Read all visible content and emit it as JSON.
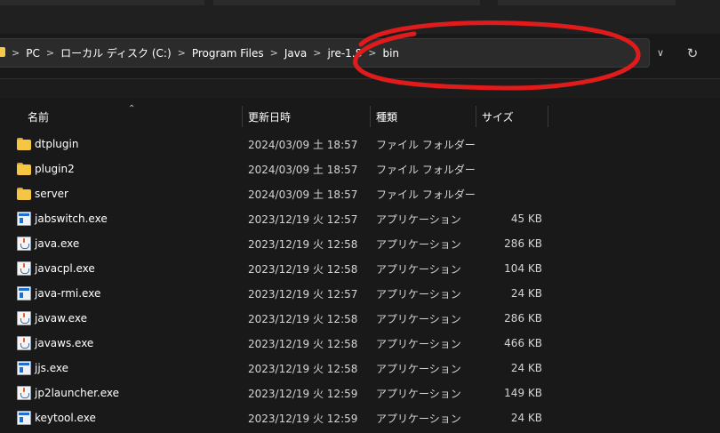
{
  "address_bar": {
    "path": [
      "PC",
      "ローカル ディスク (C:)",
      "Program Files",
      "Java",
      "jre-1.8",
      "bin"
    ]
  },
  "columns": {
    "name": "名前",
    "date": "更新日時",
    "type": "種類",
    "size": "サイズ"
  },
  "files": [
    {
      "name": "dtplugin",
      "date": "2024/03/09 土 18:57",
      "type": "ファイル フォルダー",
      "size": "",
      "icon": "folder-icon"
    },
    {
      "name": "plugin2",
      "date": "2024/03/09 土 18:57",
      "type": "ファイル フォルダー",
      "size": "",
      "icon": "folder-icon"
    },
    {
      "name": "server",
      "date": "2024/03/09 土 18:57",
      "type": "ファイル フォルダー",
      "size": "",
      "icon": "folder-icon"
    },
    {
      "name": "jabswitch.exe",
      "date": "2023/12/19 火 12:57",
      "type": "アプリケーション",
      "size": "45 KB",
      "icon": "application-icon"
    },
    {
      "name": "java.exe",
      "date": "2023/12/19 火 12:58",
      "type": "アプリケーション",
      "size": "286 KB",
      "icon": "java-icon"
    },
    {
      "name": "javacpl.exe",
      "date": "2023/12/19 火 12:58",
      "type": "アプリケーション",
      "size": "104 KB",
      "icon": "java-icon"
    },
    {
      "name": "java-rmi.exe",
      "date": "2023/12/19 火 12:57",
      "type": "アプリケーション",
      "size": "24 KB",
      "icon": "application-icon"
    },
    {
      "name": "javaw.exe",
      "date": "2023/12/19 火 12:58",
      "type": "アプリケーション",
      "size": "286 KB",
      "icon": "java-icon"
    },
    {
      "name": "javaws.exe",
      "date": "2023/12/19 火 12:58",
      "type": "アプリケーション",
      "size": "466 KB",
      "icon": "java-icon"
    },
    {
      "name": "jjs.exe",
      "date": "2023/12/19 火 12:58",
      "type": "アプリケーション",
      "size": "24 KB",
      "icon": "application-icon"
    },
    {
      "name": "jp2launcher.exe",
      "date": "2023/12/19 火 12:59",
      "type": "アプリケーション",
      "size": "149 KB",
      "icon": "java-icon"
    },
    {
      "name": "keytool.exe",
      "date": "2023/12/19 火 12:59",
      "type": "アプリケーション",
      "size": "24 KB",
      "icon": "application-icon"
    }
  ],
  "colors": {
    "background": "#191919",
    "annotation": "#e01b1b",
    "folder": "#f5c544"
  }
}
